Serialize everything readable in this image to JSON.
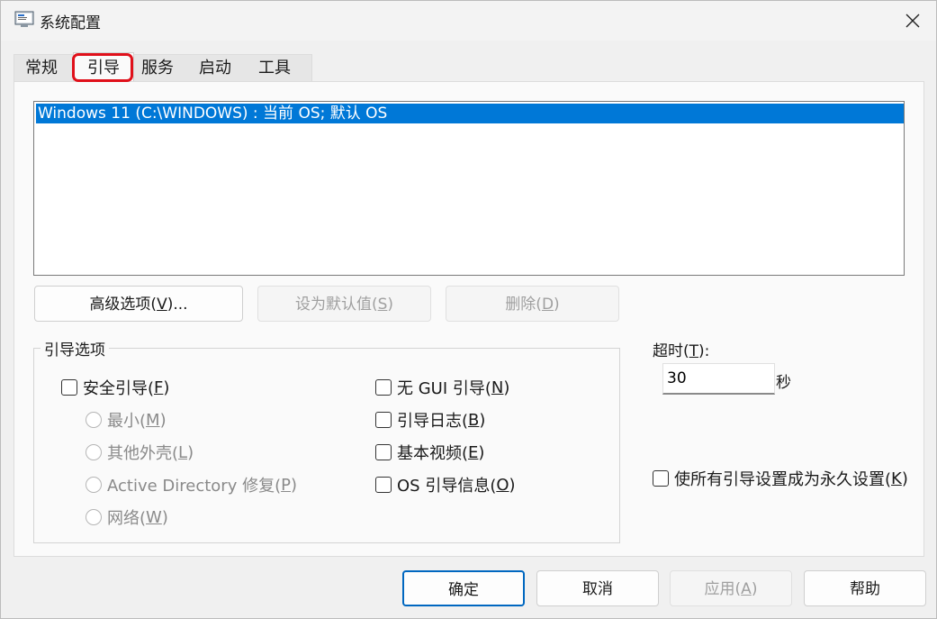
{
  "window": {
    "title": "系统配置"
  },
  "tabs": [
    {
      "label": "常规"
    },
    {
      "label": "引导"
    },
    {
      "label": "服务"
    },
    {
      "label": "启动"
    },
    {
      "label": "工具"
    }
  ],
  "boot_list": {
    "selected_entry": "Windows 11 (C:\\WINDOWS) : 当前 OS; 默认 OS"
  },
  "boot_buttons": {
    "advanced": {
      "label": "高级选项(",
      "key": "V",
      "suffix": ")..."
    },
    "set_default": {
      "label": "设为默认值(",
      "key": "S",
      "suffix": ")"
    },
    "delete": {
      "label": "删除(",
      "key": "D",
      "suffix": ")"
    }
  },
  "boot_options": {
    "title": "引导选项",
    "safe_boot": {
      "label": "安全引导(",
      "key": "F",
      "suffix": ")"
    },
    "radios": [
      {
        "label": "最小(",
        "key": "M",
        "suffix": ")"
      },
      {
        "label": "其他外壳(",
        "key": "L",
        "suffix": ")"
      },
      {
        "label": "Active Directory 修复(",
        "key": "P",
        "suffix": ")"
      },
      {
        "label": "网络(",
        "key": "W",
        "suffix": ")"
      }
    ],
    "right_checks": [
      {
        "label": "无 GUI 引导(",
        "key": "N",
        "suffix": ")"
      },
      {
        "label": "引导日志(",
        "key": "B",
        "suffix": ")"
      },
      {
        "label": "基本视频(",
        "key": "E",
        "suffix": ")"
      },
      {
        "label": "OS 引导信息(",
        "key": "O",
        "suffix": ")"
      }
    ]
  },
  "timeout": {
    "label": "超时(",
    "key": "T",
    "suffix": "):",
    "value": "30",
    "unit": "秒"
  },
  "permanent": {
    "label": "使所有引导设置成为永久设置(",
    "key": "K",
    "suffix": ")"
  },
  "footer": {
    "ok": "确定",
    "cancel": "取消",
    "apply": {
      "label": "应用(",
      "key": "A",
      "suffix": ")"
    },
    "help": "帮助"
  }
}
